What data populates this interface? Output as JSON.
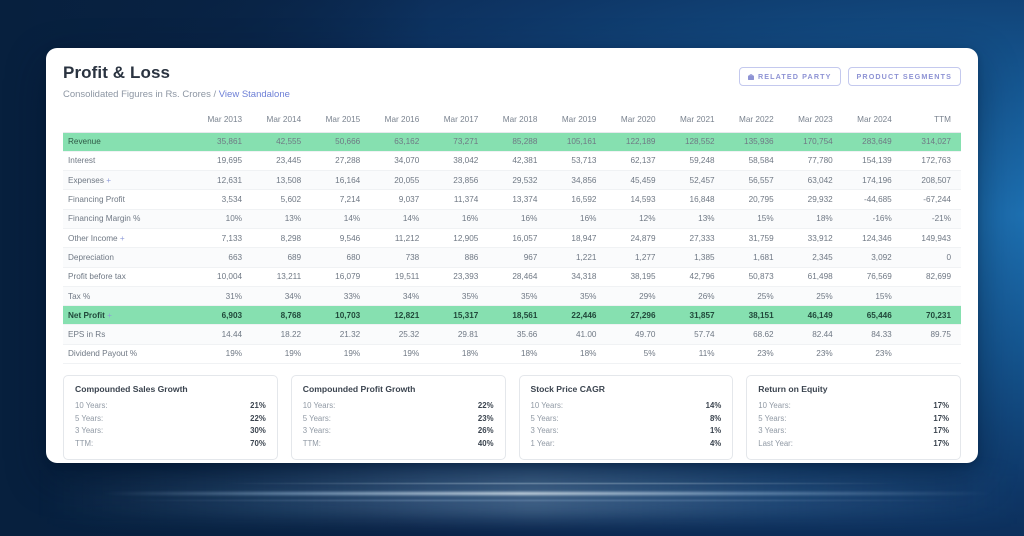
{
  "header": {
    "title": "Profit & Loss",
    "subtitle_prefix": "Consolidated Figures in Rs. Crores /",
    "subtitle_link": "View Standalone",
    "buttons": [
      {
        "label": "RELATED PARTY",
        "icon": "bank-icon",
        "has_icon": true
      },
      {
        "label": "PRODUCT SEGMENTS",
        "icon": "",
        "has_icon": false
      }
    ]
  },
  "colors": {
    "accent_green": "#86e0b0",
    "link_purple": "#6d7fd6",
    "pill_border": "#c4c9ee",
    "background_navy": "#0b2445"
  },
  "table": {
    "columns": [
      "",
      "Mar 2013",
      "Mar 2014",
      "Mar 2015",
      "Mar 2016",
      "Mar 2017",
      "Mar 2018",
      "Mar 2019",
      "Mar 2020",
      "Mar 2021",
      "Mar 2022",
      "Mar 2023",
      "Mar 2024",
      "TTM"
    ],
    "rows": [
      {
        "label": "Revenue",
        "expandable": false,
        "style": "hl",
        "values": [
          "35,861",
          "42,555",
          "50,666",
          "63,162",
          "73,271",
          "85,288",
          "105,161",
          "122,189",
          "128,552",
          "135,936",
          "170,754",
          "283,649",
          "314,027"
        ]
      },
      {
        "label": "Interest",
        "expandable": false,
        "style": "plain",
        "values": [
          "19,695",
          "23,445",
          "27,288",
          "34,070",
          "38,042",
          "42,381",
          "53,713",
          "62,137",
          "59,248",
          "58,584",
          "77,780",
          "154,139",
          "172,763"
        ]
      },
      {
        "label": "Expenses",
        "expandable": true,
        "style": "alt",
        "values": [
          "12,631",
          "13,508",
          "16,164",
          "20,055",
          "23,856",
          "29,532",
          "34,856",
          "45,459",
          "52,457",
          "56,557",
          "63,042",
          "174,196",
          "208,507"
        ]
      },
      {
        "label": "Financing Profit",
        "expandable": false,
        "style": "strong",
        "values": [
          "3,534",
          "5,602",
          "7,214",
          "9,037",
          "11,374",
          "13,374",
          "16,592",
          "14,593",
          "16,848",
          "20,795",
          "29,932",
          "-44,685",
          "-67,244"
        ]
      },
      {
        "label": "Financing Margin %",
        "expandable": false,
        "style": "alt",
        "values": [
          "10%",
          "13%",
          "14%",
          "14%",
          "16%",
          "16%",
          "16%",
          "12%",
          "13%",
          "15%",
          "18%",
          "-16%",
          "-21%"
        ]
      },
      {
        "label": "Other Income",
        "expandable": true,
        "style": "plain",
        "values": [
          "7,133",
          "8,298",
          "9,546",
          "11,212",
          "12,905",
          "16,057",
          "18,947",
          "24,879",
          "27,333",
          "31,759",
          "33,912",
          "124,346",
          "149,943"
        ]
      },
      {
        "label": "Depreciation",
        "expandable": false,
        "style": "alt",
        "values": [
          "663",
          "689",
          "680",
          "738",
          "886",
          "967",
          "1,221",
          "1,277",
          "1,385",
          "1,681",
          "2,345",
          "3,092",
          "0"
        ]
      },
      {
        "label": "Profit before tax",
        "expandable": false,
        "style": "strong",
        "values": [
          "10,004",
          "13,211",
          "16,079",
          "19,511",
          "23,393",
          "28,464",
          "34,318",
          "38,195",
          "42,796",
          "50,873",
          "61,498",
          "76,569",
          "82,699"
        ]
      },
      {
        "label": "Tax %",
        "expandable": false,
        "style": "alt",
        "values": [
          "31%",
          "34%",
          "33%",
          "34%",
          "35%",
          "35%",
          "35%",
          "29%",
          "26%",
          "25%",
          "25%",
          "15%",
          ""
        ]
      },
      {
        "label": "Net Profit",
        "expandable": true,
        "style": "hl-bold",
        "values": [
          "6,903",
          "8,768",
          "10,703",
          "12,821",
          "15,317",
          "18,561",
          "22,446",
          "27,296",
          "31,857",
          "38,151",
          "46,149",
          "65,446",
          "70,231"
        ]
      },
      {
        "label": "EPS in Rs",
        "expandable": false,
        "style": "alt",
        "values": [
          "14.44",
          "18.22",
          "21.32",
          "25.32",
          "29.81",
          "35.66",
          "41.00",
          "49.70",
          "57.74",
          "68.62",
          "82.44",
          "84.33",
          "89.75"
        ]
      },
      {
        "label": "Dividend Payout %",
        "expandable": false,
        "style": "plain",
        "values": [
          "19%",
          "19%",
          "19%",
          "19%",
          "18%",
          "18%",
          "18%",
          "5%",
          "11%",
          "23%",
          "23%",
          "23%",
          ""
        ]
      }
    ]
  },
  "summary_cards": [
    {
      "title": "Compounded Sales Growth",
      "rows": [
        {
          "label": "10 Years:",
          "value": "21%"
        },
        {
          "label": "5 Years:",
          "value": "22%"
        },
        {
          "label": "3 Years:",
          "value": "30%"
        },
        {
          "label": "TTM:",
          "value": "70%"
        }
      ]
    },
    {
      "title": "Compounded Profit Growth",
      "rows": [
        {
          "label": "10 Years:",
          "value": "22%"
        },
        {
          "label": "5 Years:",
          "value": "23%"
        },
        {
          "label": "3 Years:",
          "value": "26%"
        },
        {
          "label": "TTM:",
          "value": "40%"
        }
      ]
    },
    {
      "title": "Stock Price CAGR",
      "rows": [
        {
          "label": "10 Years:",
          "value": "14%"
        },
        {
          "label": "5 Years:",
          "value": "8%"
        },
        {
          "label": "3 Years:",
          "value": "1%"
        },
        {
          "label": "1 Year:",
          "value": "4%"
        }
      ]
    },
    {
      "title": "Return on Equity",
      "rows": [
        {
          "label": "10 Years:",
          "value": "17%"
        },
        {
          "label": "5 Years:",
          "value": "17%"
        },
        {
          "label": "3 Years:",
          "value": "17%"
        },
        {
          "label": "Last Year:",
          "value": "17%"
        }
      ]
    }
  ]
}
